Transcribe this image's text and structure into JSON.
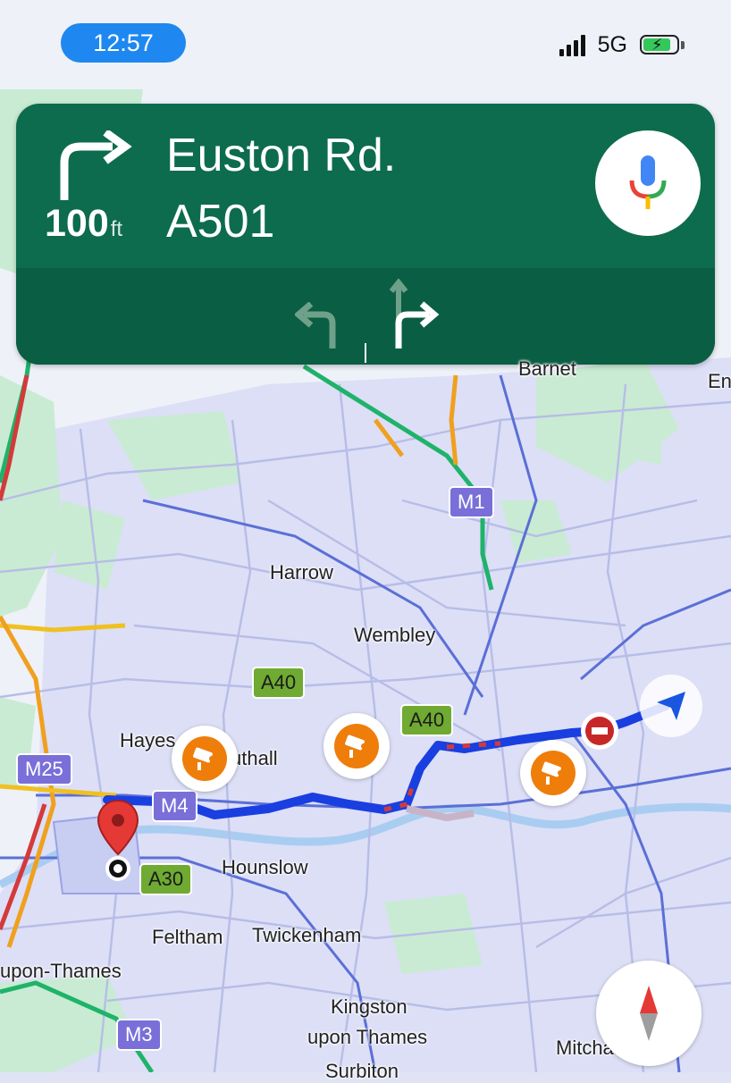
{
  "status_bar": {
    "time": "12:57",
    "network": "5G",
    "battery_state": "charging"
  },
  "navigation": {
    "turn_icon": "turn-right-icon",
    "distance_value": "100",
    "distance_unit": "ft",
    "street_name": "Euston Rd.",
    "road_number": "A501",
    "voice_icon": "microphone-icon",
    "lanes": [
      {
        "icon": "turn-left-lane-icon",
        "active": false
      },
      {
        "icon": "straight-or-right-lane-icon",
        "active": true
      }
    ]
  },
  "map": {
    "places": {
      "barnet": "Barnet",
      "en": "En",
      "harrow": "Harrow",
      "wembley": "Wembley",
      "hayes": "Hayes",
      "southall": "uthall",
      "hounslow": "Hounslow",
      "feltham": "Feltham",
      "twickenham": "Twickenham",
      "upon_thames": "upon-Thames",
      "kingston": "Kingston",
      "kingston2": "upon Thames",
      "mitcham": "Mitcham",
      "surbiton": "Surbiton"
    },
    "road_shields": {
      "m1_top": "M1",
      "m1": "M1",
      "m25": "M25",
      "m4": "M4",
      "m3": "M3",
      "a40_a": "A40",
      "a40_b": "A40",
      "a30": "A30"
    },
    "markers": [
      "destination-pin-icon",
      "speed-camera-icon",
      "road-closure-icon",
      "current-location-arrow-icon"
    ],
    "compass_icon": "compass-icon",
    "colors": {
      "route": "#1a3fe0",
      "traffic_heavy": "#d33a3a",
      "traffic_medium": "#f0a020",
      "traffic_free": "#1fb36a",
      "nav_banner": "#0d6c4d",
      "camera": "#ef7d0a"
    }
  }
}
